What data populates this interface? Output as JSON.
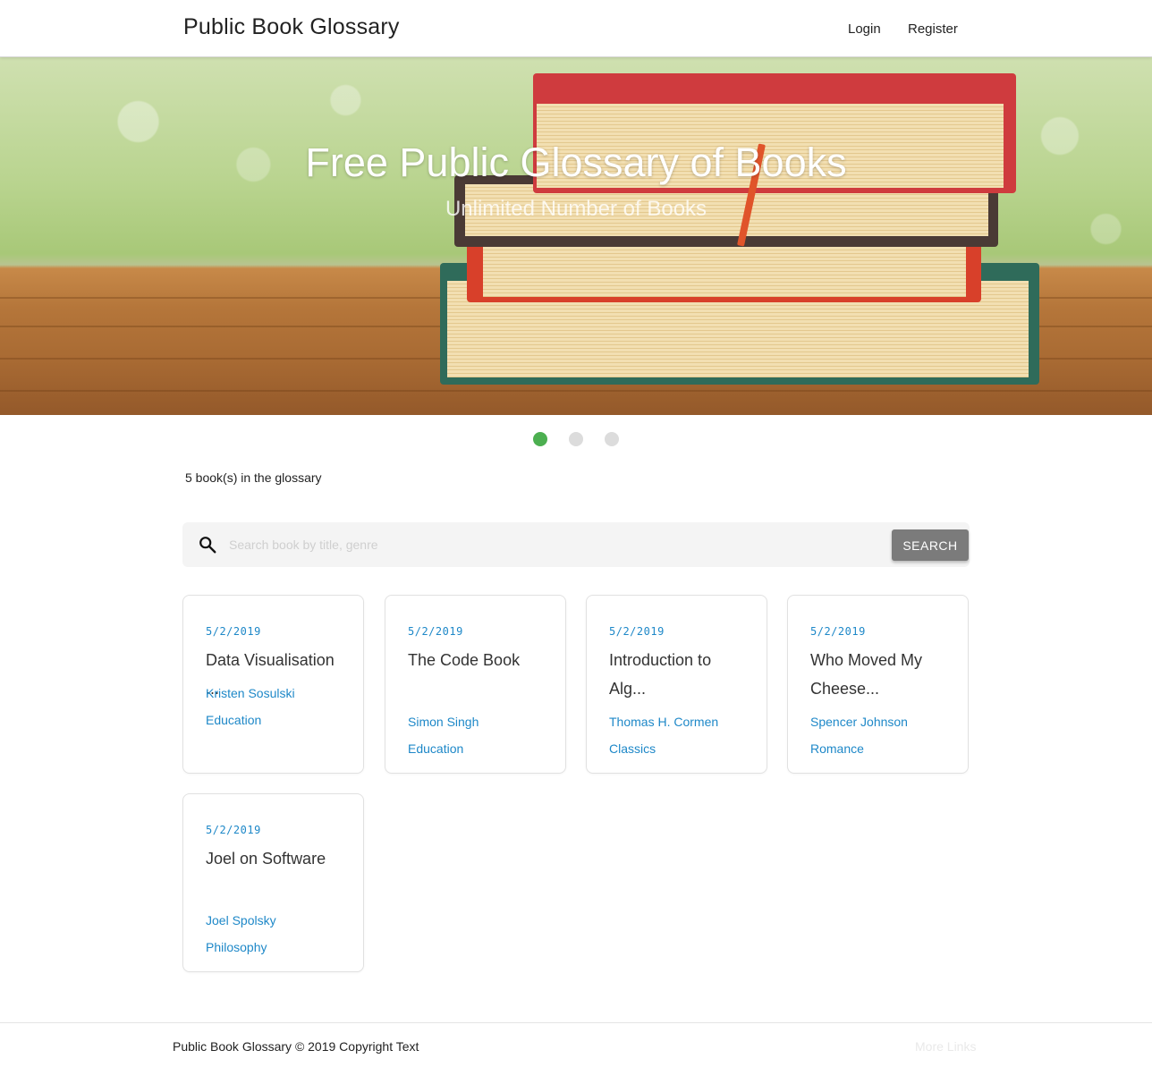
{
  "header": {
    "brand": "Public Book Glossary",
    "nav": {
      "login": "Login",
      "register": "Register"
    }
  },
  "hero": {
    "title": "Free Public Glossary of Books",
    "subtitle": "Unlimited Number of Books",
    "slide_count": 3,
    "active_slide": 1
  },
  "summary": {
    "count_text": "5 book(s) in the glossary"
  },
  "search": {
    "placeholder": "Search book by title, genre",
    "value": "",
    "button_label": "SEARCH"
  },
  "books": [
    {
      "date": "5/2/2019",
      "title": "Data Visualisation ...",
      "author": "Kristen Sosulski",
      "genre": "Education"
    },
    {
      "date": "5/2/2019",
      "title": "The Code Book",
      "author": "Simon Singh",
      "genre": "Education"
    },
    {
      "date": "5/2/2019",
      "title": "Introduction to Alg...",
      "author": "Thomas H. Cormen",
      "genre": "Classics"
    },
    {
      "date": "5/2/2019",
      "title": "Who Moved My Cheese...",
      "author": "Spencer Johnson",
      "genre": "Romance"
    },
    {
      "date": "5/2/2019",
      "title": "Joel on Software",
      "author": "Joel Spolsky",
      "genre": "Philosophy"
    }
  ],
  "footer": {
    "copyright": "Public Book Glossary © 2019 Copyright Text",
    "more_links": "More Links"
  },
  "colors": {
    "accent_link": "#1e88c8",
    "active_dot": "#4caf50",
    "search_button": "#7b7b7b"
  },
  "icons": {
    "search": "search-icon"
  }
}
